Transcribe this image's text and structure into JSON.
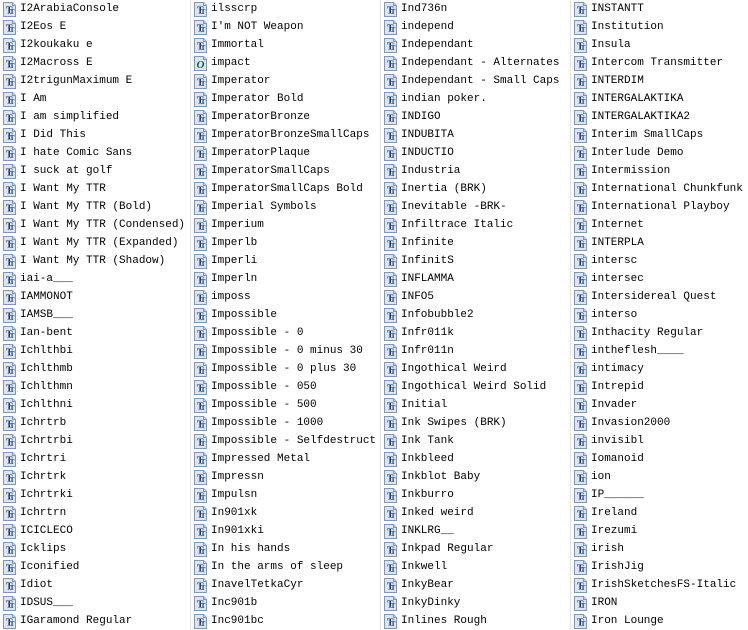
{
  "window": {
    "title": "Fonts",
    "view": "list",
    "icon_truetype": "truetype-font-icon",
    "icon_opentype": "opentype-font-icon",
    "colors": {
      "background": "#ffffff",
      "text": "#000000",
      "icon_fill": "#dce6f4",
      "icon_border": "#7a93b5",
      "icon_glyph": "#1f3864",
      "separator": "#e3e3e3"
    }
  },
  "columns": [
    {
      "index": 0,
      "items": [
        {
          "name": "I2ArabiaConsole",
          "type": "truetype"
        },
        {
          "name": "I2Eos E",
          "type": "truetype"
        },
        {
          "name": "I2koukaku e",
          "type": "truetype"
        },
        {
          "name": "I2Macross E",
          "type": "truetype"
        },
        {
          "name": "I2trigunMaximum E",
          "type": "truetype"
        },
        {
          "name": "I Am",
          "type": "truetype"
        },
        {
          "name": "I am simplified",
          "type": "truetype"
        },
        {
          "name": "I Did This",
          "type": "truetype"
        },
        {
          "name": "I hate Comic Sans",
          "type": "truetype"
        },
        {
          "name": "I suck at golf",
          "type": "truetype"
        },
        {
          "name": "I Want My TTR",
          "type": "truetype"
        },
        {
          "name": "I Want My TTR (Bold)",
          "type": "truetype"
        },
        {
          "name": "I Want My TTR (Condensed)",
          "type": "truetype"
        },
        {
          "name": "I Want My TTR (Expanded)",
          "type": "truetype"
        },
        {
          "name": "I Want My TTR (Shadow)",
          "type": "truetype"
        },
        {
          "name": "iai-a___",
          "type": "truetype"
        },
        {
          "name": "IAMMONOT",
          "type": "truetype"
        },
        {
          "name": "IAMSB___",
          "type": "truetype"
        },
        {
          "name": "Ian-bent",
          "type": "truetype"
        },
        {
          "name": "Ichlthbi",
          "type": "truetype"
        },
        {
          "name": "Ichlthmb",
          "type": "truetype"
        },
        {
          "name": "Ichlthmn",
          "type": "truetype"
        },
        {
          "name": "Ichlthni",
          "type": "truetype"
        },
        {
          "name": "Ichrtrb",
          "type": "truetype"
        },
        {
          "name": "Ichrtrbi",
          "type": "truetype"
        },
        {
          "name": "Ichrtri",
          "type": "truetype"
        },
        {
          "name": "Ichrtrk",
          "type": "truetype"
        },
        {
          "name": "Ichrtrki",
          "type": "truetype"
        },
        {
          "name": "Ichrtrn",
          "type": "truetype"
        },
        {
          "name": "ICICLECO",
          "type": "truetype"
        },
        {
          "name": "Icklips",
          "type": "truetype"
        },
        {
          "name": "Iconified",
          "type": "truetype"
        },
        {
          "name": "Idiot",
          "type": "truetype"
        },
        {
          "name": "IDSUS___",
          "type": "truetype"
        },
        {
          "name": "IGaramond Regular",
          "type": "truetype"
        }
      ]
    },
    {
      "index": 1,
      "items": [
        {
          "name": "ilsscrp",
          "type": "truetype"
        },
        {
          "name": "I'm NOT Weapon",
          "type": "truetype"
        },
        {
          "name": "Immortal",
          "type": "truetype"
        },
        {
          "name": "impact",
          "type": "opentype"
        },
        {
          "name": "Imperator",
          "type": "truetype"
        },
        {
          "name": "Imperator Bold",
          "type": "truetype"
        },
        {
          "name": "ImperatorBronze",
          "type": "truetype"
        },
        {
          "name": "ImperatorBronzeSmallCaps",
          "type": "truetype"
        },
        {
          "name": "ImperatorPlaque",
          "type": "truetype"
        },
        {
          "name": "ImperatorSmallCaps",
          "type": "truetype"
        },
        {
          "name": "ImperatorSmallCaps Bold",
          "type": "truetype"
        },
        {
          "name": "Imperial Symbols",
          "type": "truetype"
        },
        {
          "name": "Imperium",
          "type": "truetype"
        },
        {
          "name": "Imperlb",
          "type": "truetype"
        },
        {
          "name": "Imperli",
          "type": "truetype"
        },
        {
          "name": "Imperln",
          "type": "truetype"
        },
        {
          "name": "imposs",
          "type": "truetype"
        },
        {
          "name": "Impossible",
          "type": "truetype"
        },
        {
          "name": "Impossible - 0",
          "type": "truetype"
        },
        {
          "name": "Impossible - 0 minus 30",
          "type": "truetype"
        },
        {
          "name": "Impossible - 0 plus 30",
          "type": "truetype"
        },
        {
          "name": "Impossible - 050",
          "type": "truetype"
        },
        {
          "name": "Impossible - 500",
          "type": "truetype"
        },
        {
          "name": "Impossible - 1000",
          "type": "truetype"
        },
        {
          "name": "Impossible - Selfdestruct",
          "type": "truetype"
        },
        {
          "name": "Impressed Metal",
          "type": "truetype"
        },
        {
          "name": "Impressn",
          "type": "truetype"
        },
        {
          "name": "Impulsn",
          "type": "truetype"
        },
        {
          "name": "In901xk",
          "type": "truetype"
        },
        {
          "name": "In901xki",
          "type": "truetype"
        },
        {
          "name": "In his hands",
          "type": "truetype"
        },
        {
          "name": "In the arms of sleep",
          "type": "truetype"
        },
        {
          "name": "InavelTetkaCyr",
          "type": "truetype"
        },
        {
          "name": "Inc901b",
          "type": "truetype"
        },
        {
          "name": "Inc901bc",
          "type": "truetype"
        }
      ]
    },
    {
      "index": 2,
      "items": [
        {
          "name": "Ind736n",
          "type": "truetype"
        },
        {
          "name": "independ",
          "type": "truetype"
        },
        {
          "name": "Independant",
          "type": "truetype"
        },
        {
          "name": "Independant - Alternates",
          "type": "truetype"
        },
        {
          "name": "Independant - Small Caps",
          "type": "truetype"
        },
        {
          "name": "indian poker.",
          "type": "truetype"
        },
        {
          "name": "INDIGO",
          "type": "truetype"
        },
        {
          "name": "INDUBITA",
          "type": "truetype"
        },
        {
          "name": "INDUCTIO",
          "type": "truetype"
        },
        {
          "name": "Industria",
          "type": "truetype"
        },
        {
          "name": "Inertia (BRK)",
          "type": "truetype"
        },
        {
          "name": "Inevitable -BRK-",
          "type": "truetype"
        },
        {
          "name": "Infiltrace Italic",
          "type": "truetype"
        },
        {
          "name": "Infinite",
          "type": "truetype"
        },
        {
          "name": "InfinitS",
          "type": "truetype"
        },
        {
          "name": "INFLAMMA",
          "type": "truetype"
        },
        {
          "name": "INFO5",
          "type": "truetype"
        },
        {
          "name": "Infobubble2",
          "type": "truetype"
        },
        {
          "name": "Infr011k",
          "type": "truetype"
        },
        {
          "name": "Infr011n",
          "type": "truetype"
        },
        {
          "name": "Ingothical Weird",
          "type": "truetype"
        },
        {
          "name": "Ingothical Weird Solid",
          "type": "truetype"
        },
        {
          "name": "Initial",
          "type": "truetype"
        },
        {
          "name": "Ink Swipes (BRK)",
          "type": "truetype"
        },
        {
          "name": "Ink Tank",
          "type": "truetype"
        },
        {
          "name": "Inkbleed",
          "type": "truetype"
        },
        {
          "name": "Inkblot Baby",
          "type": "truetype"
        },
        {
          "name": "Inkburro",
          "type": "truetype"
        },
        {
          "name": "Inked weird",
          "type": "truetype"
        },
        {
          "name": "INKLRG__",
          "type": "truetype"
        },
        {
          "name": "Inkpad Regular",
          "type": "truetype"
        },
        {
          "name": "Inkwell",
          "type": "truetype"
        },
        {
          "name": "InkyBear",
          "type": "truetype"
        },
        {
          "name": "InkyDinky",
          "type": "truetype"
        },
        {
          "name": "Inlines Rough",
          "type": "truetype"
        }
      ]
    },
    {
      "index": 3,
      "items": [
        {
          "name": "INSTANTT",
          "type": "truetype"
        },
        {
          "name": "Institution",
          "type": "truetype"
        },
        {
          "name": "Insula",
          "type": "truetype"
        },
        {
          "name": "Intercom Transmitter",
          "type": "truetype"
        },
        {
          "name": "INTERDIM",
          "type": "truetype"
        },
        {
          "name": "INTERGALAKTIKA",
          "type": "truetype"
        },
        {
          "name": "INTERGALAKTIKA2",
          "type": "truetype"
        },
        {
          "name": "Interim SmallCaps",
          "type": "truetype"
        },
        {
          "name": "Interlude Demo",
          "type": "truetype"
        },
        {
          "name": "Intermission",
          "type": "truetype"
        },
        {
          "name": "International Chunkfunk",
          "type": "truetype"
        },
        {
          "name": "International Playboy",
          "type": "truetype"
        },
        {
          "name": "Internet",
          "type": "truetype"
        },
        {
          "name": "INTERPLA",
          "type": "truetype"
        },
        {
          "name": "intersc",
          "type": "truetype"
        },
        {
          "name": "intersec",
          "type": "truetype"
        },
        {
          "name": "Intersidereal Quest",
          "type": "truetype"
        },
        {
          "name": "interso",
          "type": "truetype"
        },
        {
          "name": "Inthacity Regular",
          "type": "truetype"
        },
        {
          "name": "intheflesh____",
          "type": "truetype"
        },
        {
          "name": "intimacy",
          "type": "truetype"
        },
        {
          "name": "Intrepid",
          "type": "truetype"
        },
        {
          "name": "Invader",
          "type": "truetype"
        },
        {
          "name": "Invasion2000",
          "type": "truetype"
        },
        {
          "name": "invisibl",
          "type": "truetype"
        },
        {
          "name": "Iomanoid",
          "type": "truetype"
        },
        {
          "name": "ion",
          "type": "truetype"
        },
        {
          "name": "IP______",
          "type": "truetype"
        },
        {
          "name": "Ireland",
          "type": "truetype"
        },
        {
          "name": "Irezumi",
          "type": "truetype"
        },
        {
          "name": "irish",
          "type": "truetype"
        },
        {
          "name": "IrishJig",
          "type": "truetype"
        },
        {
          "name": "IrishSketchesFS-Italic",
          "type": "truetype"
        },
        {
          "name": "IRON",
          "type": "truetype"
        },
        {
          "name": "Iron Lounge",
          "type": "truetype"
        }
      ]
    }
  ]
}
